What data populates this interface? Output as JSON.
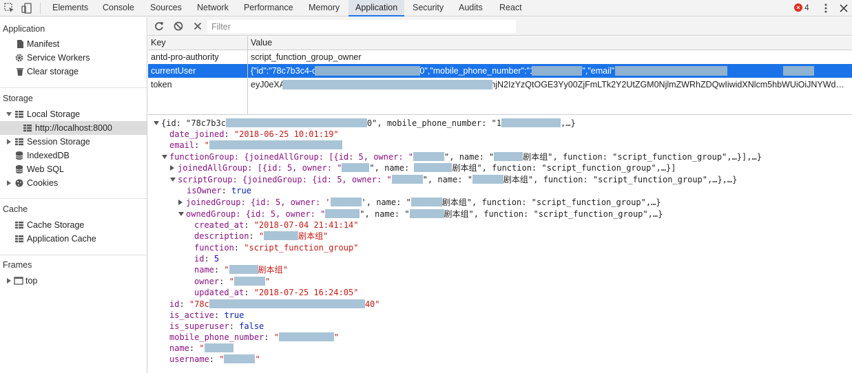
{
  "topbar": {
    "tabs": [
      "Elements",
      "Console",
      "Sources",
      "Network",
      "Performance",
      "Memory",
      "Application",
      "Security",
      "Audits",
      "React"
    ],
    "active_tab": "Application",
    "error_count": "4"
  },
  "sidebar": {
    "application": {
      "title": "Application",
      "items": [
        "Manifest",
        "Service Workers",
        "Clear storage"
      ]
    },
    "storage": {
      "title": "Storage",
      "local_storage": "Local Storage",
      "local_origin": "http://localhost:8000",
      "session_storage": "Session Storage",
      "indexeddb": "IndexedDB",
      "websql": "Web SQL",
      "cookies": "Cookies"
    },
    "cache": {
      "title": "Cache",
      "items": [
        "Cache Storage",
        "Application Cache"
      ]
    },
    "frames": {
      "title": "Frames",
      "top": "top"
    }
  },
  "toolbar": {
    "filter_placeholder": "Filter"
  },
  "table": {
    "headers": {
      "key": "Key",
      "value": "Value"
    },
    "rows": [
      {
        "key": "antd-pro-authority",
        "value": "script_function_group_owner"
      },
      {
        "key": "currentUser",
        "value": "{\"id\":\"78c7b3c4-ca70-4f1f-8e0d-d54c8c8ad40\",\"mobile_phone_number\":\"13800000008\",\"email\":\"                                 \",\"username\":\"           \",\"name\":\"..."
      },
      {
        "key": "token",
        "value": "eyJ0eXAiOiJKV1QiLCJhbGciOiJIUzI1NiJ9.eyJ1c2VyX2lkIjoiNzhjN2IzYzQtOGE3Yy00ZjFmLTk2Y2UtZGM0NjlmZWRhZDQwIiwidXNlcm5hbWUiOiJNYWdnaWUiL..."
      }
    ]
  },
  "preview": {
    "root_open": "{id: \"78c7b3c",
    "root_tail1": "0\", mobile_phone_number: \"1",
    "root_tail2": ",…}",
    "date_joined": "\"2018-06-25 10:01:19\"",
    "fg_head": "functionGroup: {joinedAllGroup: [{id: 5, owner: \"",
    "fg_mid": "\", name: \"",
    "fg_tail": "剧本组\", function: \"script_function_group\",…}],…}",
    "jag_head": "joinedAllGroup: [{id: 5, owner: \"",
    "jag_mid": "\", name: ",
    "jag_tail": "剧本组\", function: \"script_function_group\",…}]",
    "sg_head": "scriptGroup: {joinedGroup: {id: 5, owner: \"",
    "sg_mid": "\", name: \"",
    "sg_tail": "剧本组\", function: \"script_function_group\",…},…}",
    "is_owner": "true",
    "jg_head": "joinedGroup: {id: 5, owner: '",
    "jg_mid": "', name: \"",
    "jg_tail": "剧本组\", function: \"script_function_group\",…}",
    "og_head": "ownedGroup: {id: 5, owner: \"",
    "og_mid": "\", name: \"",
    "og_tail": "剧本组\", function: \"script_function_group\",…}",
    "created_at": "\"2018-07-04 21:41:14\"",
    "description_tail": "剧本组\"",
    "function": "\"script_function_group\"",
    "id_num": "5",
    "name_tail": "剧本组\"",
    "updated_at": "\"2018-07-25 16:24:05\"",
    "id_head": "\"78c",
    "id_tail": "40\"",
    "is_active": "true",
    "is_superuser": "false"
  }
}
